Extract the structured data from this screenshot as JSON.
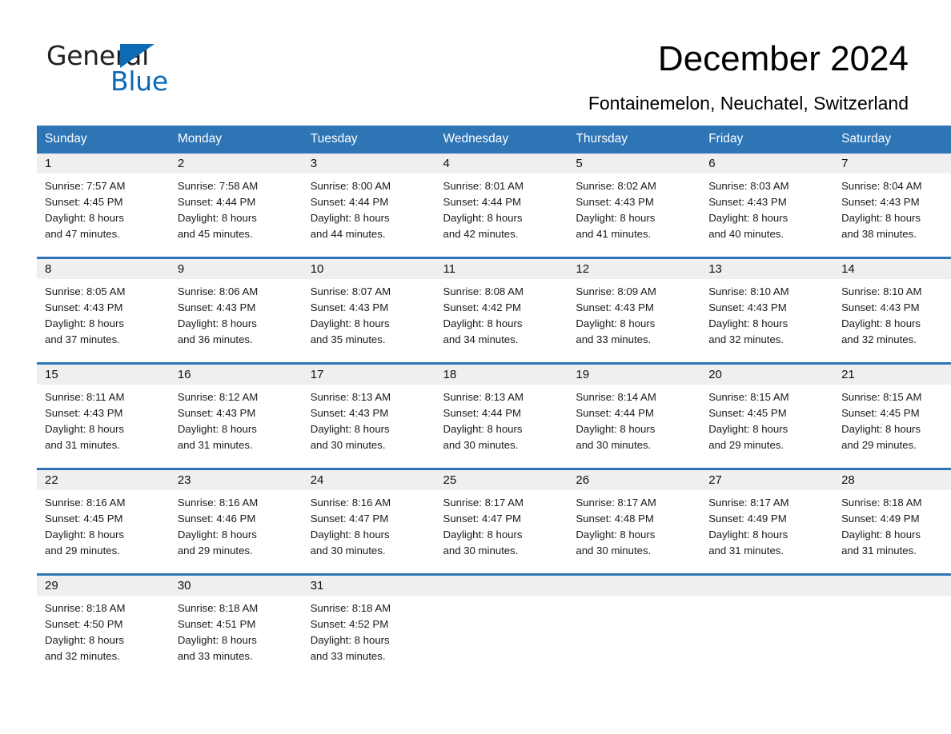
{
  "logo": {
    "line1": "General",
    "line2": "Blue",
    "triangle_color": "#0d6cb3",
    "blue_color": "#0b6ab8"
  },
  "header": {
    "title": "December 2024",
    "subtitle": "Fontainemelon, Neuchatel, Switzerland"
  },
  "theme": {
    "header_blue": "#2e75b6",
    "daynum_band": "#efefef",
    "text": "#000000"
  },
  "weekday_headers": [
    "Sunday",
    "Monday",
    "Tuesday",
    "Wednesday",
    "Thursday",
    "Friday",
    "Saturday"
  ],
  "weeks": [
    [
      {
        "day": "1",
        "sunrise": "Sunrise: 7:57 AM",
        "sunset": "Sunset: 4:45 PM",
        "daylight1": "Daylight: 8 hours",
        "daylight2": "and 47 minutes."
      },
      {
        "day": "2",
        "sunrise": "Sunrise: 7:58 AM",
        "sunset": "Sunset: 4:44 PM",
        "daylight1": "Daylight: 8 hours",
        "daylight2": "and 45 minutes."
      },
      {
        "day": "3",
        "sunrise": "Sunrise: 8:00 AM",
        "sunset": "Sunset: 4:44 PM",
        "daylight1": "Daylight: 8 hours",
        "daylight2": "and 44 minutes."
      },
      {
        "day": "4",
        "sunrise": "Sunrise: 8:01 AM",
        "sunset": "Sunset: 4:44 PM",
        "daylight1": "Daylight: 8 hours",
        "daylight2": "and 42 minutes."
      },
      {
        "day": "5",
        "sunrise": "Sunrise: 8:02 AM",
        "sunset": "Sunset: 4:43 PM",
        "daylight1": "Daylight: 8 hours",
        "daylight2": "and 41 minutes."
      },
      {
        "day": "6",
        "sunrise": "Sunrise: 8:03 AM",
        "sunset": "Sunset: 4:43 PM",
        "daylight1": "Daylight: 8 hours",
        "daylight2": "and 40 minutes."
      },
      {
        "day": "7",
        "sunrise": "Sunrise: 8:04 AM",
        "sunset": "Sunset: 4:43 PM",
        "daylight1": "Daylight: 8 hours",
        "daylight2": "and 38 minutes."
      }
    ],
    [
      {
        "day": "8",
        "sunrise": "Sunrise: 8:05 AM",
        "sunset": "Sunset: 4:43 PM",
        "daylight1": "Daylight: 8 hours",
        "daylight2": "and 37 minutes."
      },
      {
        "day": "9",
        "sunrise": "Sunrise: 8:06 AM",
        "sunset": "Sunset: 4:43 PM",
        "daylight1": "Daylight: 8 hours",
        "daylight2": "and 36 minutes."
      },
      {
        "day": "10",
        "sunrise": "Sunrise: 8:07 AM",
        "sunset": "Sunset: 4:43 PM",
        "daylight1": "Daylight: 8 hours",
        "daylight2": "and 35 minutes."
      },
      {
        "day": "11",
        "sunrise": "Sunrise: 8:08 AM",
        "sunset": "Sunset: 4:42 PM",
        "daylight1": "Daylight: 8 hours",
        "daylight2": "and 34 minutes."
      },
      {
        "day": "12",
        "sunrise": "Sunrise: 8:09 AM",
        "sunset": "Sunset: 4:43 PM",
        "daylight1": "Daylight: 8 hours",
        "daylight2": "and 33 minutes."
      },
      {
        "day": "13",
        "sunrise": "Sunrise: 8:10 AM",
        "sunset": "Sunset: 4:43 PM",
        "daylight1": "Daylight: 8 hours",
        "daylight2": "and 32 minutes."
      },
      {
        "day": "14",
        "sunrise": "Sunrise: 8:10 AM",
        "sunset": "Sunset: 4:43 PM",
        "daylight1": "Daylight: 8 hours",
        "daylight2": "and 32 minutes."
      }
    ],
    [
      {
        "day": "15",
        "sunrise": "Sunrise: 8:11 AM",
        "sunset": "Sunset: 4:43 PM",
        "daylight1": "Daylight: 8 hours",
        "daylight2": "and 31 minutes."
      },
      {
        "day": "16",
        "sunrise": "Sunrise: 8:12 AM",
        "sunset": "Sunset: 4:43 PM",
        "daylight1": "Daylight: 8 hours",
        "daylight2": "and 31 minutes."
      },
      {
        "day": "17",
        "sunrise": "Sunrise: 8:13 AM",
        "sunset": "Sunset: 4:43 PM",
        "daylight1": "Daylight: 8 hours",
        "daylight2": "and 30 minutes."
      },
      {
        "day": "18",
        "sunrise": "Sunrise: 8:13 AM",
        "sunset": "Sunset: 4:44 PM",
        "daylight1": "Daylight: 8 hours",
        "daylight2": "and 30 minutes."
      },
      {
        "day": "19",
        "sunrise": "Sunrise: 8:14 AM",
        "sunset": "Sunset: 4:44 PM",
        "daylight1": "Daylight: 8 hours",
        "daylight2": "and 30 minutes."
      },
      {
        "day": "20",
        "sunrise": "Sunrise: 8:15 AM",
        "sunset": "Sunset: 4:45 PM",
        "daylight1": "Daylight: 8 hours",
        "daylight2": "and 29 minutes."
      },
      {
        "day": "21",
        "sunrise": "Sunrise: 8:15 AM",
        "sunset": "Sunset: 4:45 PM",
        "daylight1": "Daylight: 8 hours",
        "daylight2": "and 29 minutes."
      }
    ],
    [
      {
        "day": "22",
        "sunrise": "Sunrise: 8:16 AM",
        "sunset": "Sunset: 4:45 PM",
        "daylight1": "Daylight: 8 hours",
        "daylight2": "and 29 minutes."
      },
      {
        "day": "23",
        "sunrise": "Sunrise: 8:16 AM",
        "sunset": "Sunset: 4:46 PM",
        "daylight1": "Daylight: 8 hours",
        "daylight2": "and 29 minutes."
      },
      {
        "day": "24",
        "sunrise": "Sunrise: 8:16 AM",
        "sunset": "Sunset: 4:47 PM",
        "daylight1": "Daylight: 8 hours",
        "daylight2": "and 30 minutes."
      },
      {
        "day": "25",
        "sunrise": "Sunrise: 8:17 AM",
        "sunset": "Sunset: 4:47 PM",
        "daylight1": "Daylight: 8 hours",
        "daylight2": "and 30 minutes."
      },
      {
        "day": "26",
        "sunrise": "Sunrise: 8:17 AM",
        "sunset": "Sunset: 4:48 PM",
        "daylight1": "Daylight: 8 hours",
        "daylight2": "and 30 minutes."
      },
      {
        "day": "27",
        "sunrise": "Sunrise: 8:17 AM",
        "sunset": "Sunset: 4:49 PM",
        "daylight1": "Daylight: 8 hours",
        "daylight2": "and 31 minutes."
      },
      {
        "day": "28",
        "sunrise": "Sunrise: 8:18 AM",
        "sunset": "Sunset: 4:49 PM",
        "daylight1": "Daylight: 8 hours",
        "daylight2": "and 31 minutes."
      }
    ],
    [
      {
        "day": "29",
        "sunrise": "Sunrise: 8:18 AM",
        "sunset": "Sunset: 4:50 PM",
        "daylight1": "Daylight: 8 hours",
        "daylight2": "and 32 minutes."
      },
      {
        "day": "30",
        "sunrise": "Sunrise: 8:18 AM",
        "sunset": "Sunset: 4:51 PM",
        "daylight1": "Daylight: 8 hours",
        "daylight2": "and 33 minutes."
      },
      {
        "day": "31",
        "sunrise": "Sunrise: 8:18 AM",
        "sunset": "Sunset: 4:52 PM",
        "daylight1": "Daylight: 8 hours",
        "daylight2": "and 33 minutes."
      },
      {
        "day": "",
        "sunrise": "",
        "sunset": "",
        "daylight1": "",
        "daylight2": ""
      },
      {
        "day": "",
        "sunrise": "",
        "sunset": "",
        "daylight1": "",
        "daylight2": ""
      },
      {
        "day": "",
        "sunrise": "",
        "sunset": "",
        "daylight1": "",
        "daylight2": ""
      },
      {
        "day": "",
        "sunrise": "",
        "sunset": "",
        "daylight1": "",
        "daylight2": ""
      }
    ]
  ]
}
